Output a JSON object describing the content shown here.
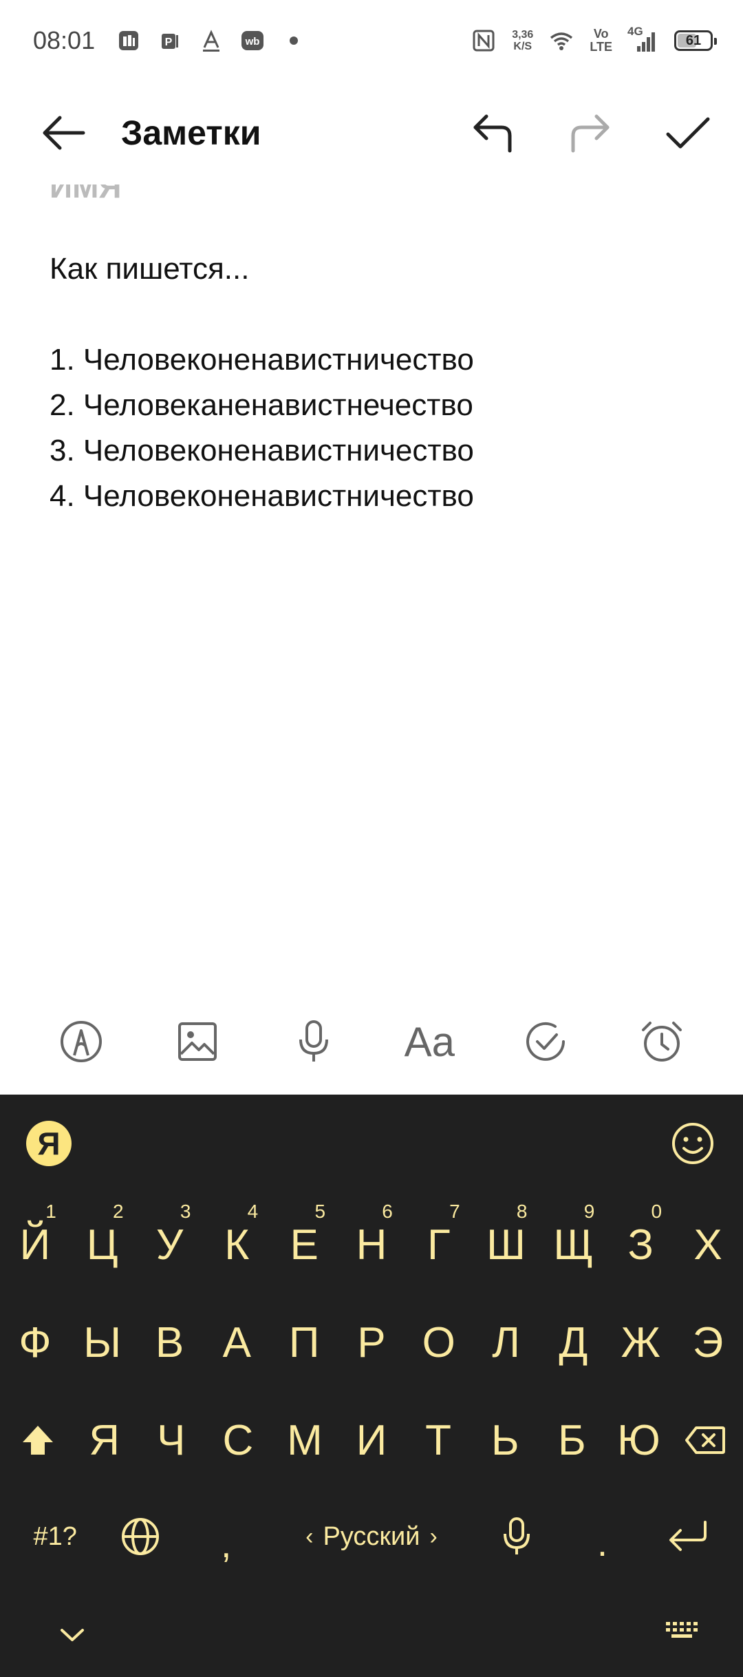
{
  "status_bar": {
    "time": "08:01",
    "net_speed_value": "3,36",
    "net_speed_unit": "K/S",
    "volte_top": "Vo",
    "volte_bottom": "LTE",
    "network": "4G",
    "battery": "61",
    "battery_level": 0.61,
    "notification_icons": [
      "app-icon-1",
      "app-icon-2",
      "text-a-icon",
      "wb-icon",
      "dot-icon"
    ],
    "status_icons": [
      "nfc-icon",
      "wifi-icon",
      "signal-icon",
      "battery-icon"
    ]
  },
  "app_bar": {
    "title": "Заметки",
    "back_icon": "back-arrow-icon",
    "undo_icon": "undo-icon",
    "redo_icon": "redo-icon",
    "done_icon": "check-icon"
  },
  "note": {
    "clipped_line": "ИМЯ",
    "intro": "Как пишется...",
    "lines": [
      "1. Человеконенавистничество",
      "2. Человеканенавистнечество",
      "3. Человеконенавистничество",
      "4. Человеконенавистничество"
    ]
  },
  "format_bar": {
    "tools": [
      "pen-icon",
      "image-icon",
      "microphone-icon",
      "text-format-icon",
      "checklist-icon",
      "alarm-icon"
    ],
    "text_format_label": "Aa"
  },
  "keyboard": {
    "logo": "Я",
    "row1": [
      "Й",
      "Ц",
      "У",
      "К",
      "Е",
      "Н",
      "Г",
      "Ш",
      "Щ",
      "З",
      "Х"
    ],
    "row1_hints": [
      "1",
      "2",
      "3",
      "4",
      "5",
      "6",
      "7",
      "8",
      "9",
      "0",
      ""
    ],
    "row2": [
      "Ф",
      "Ы",
      "В",
      "А",
      "П",
      "Р",
      "О",
      "Л",
      "Д",
      "Ж",
      "Э"
    ],
    "row3": [
      "Я",
      "Ч",
      "С",
      "М",
      "И",
      "Т",
      "Ь",
      "Б",
      "Ю"
    ],
    "symbols_label": "#1?",
    "comma": ",",
    "language": "Русский",
    "period": ".",
    "accent_color": "#fbeaa0",
    "background": "#202020"
  }
}
